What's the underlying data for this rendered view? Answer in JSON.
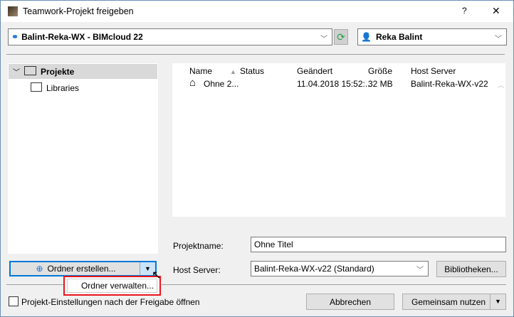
{
  "title": "Teamwork-Projekt freigeben",
  "title_buttons": {
    "help": "?",
    "close": "✕"
  },
  "server_combo": "Balint-Reka-WX - BIMcloud 22",
  "user_combo": "Reka Balint",
  "tree": [
    {
      "label": "Projekte"
    },
    {
      "label": "Libraries"
    }
  ],
  "table": {
    "columns": [
      "Name",
      "Status",
      "Geändert",
      "Größe",
      "Host Server"
    ],
    "rows": [
      {
        "name": "Ohne 2...",
        "status": "",
        "changed": "11.04.2018 15:52:...",
        "size": "32 MB",
        "host": "Balint-Reka-WX-v22"
      }
    ]
  },
  "form": {
    "name_label": "Projektname:",
    "name_value": "Ohne Titel",
    "host_label": "Host Server:",
    "host_value": "Balint-Reka-WX-v22 (Standard)",
    "libraries_button": "Bibliotheken..."
  },
  "create_folder": "Ordner erstellen...",
  "dropdown_item": "Ordner verwalten...",
  "checkbox_label": "Projekt-Einstellungen nach der Freigabe öffnen",
  "cancel": "Abbrechen",
  "share": "Gemeinsam nutzen"
}
